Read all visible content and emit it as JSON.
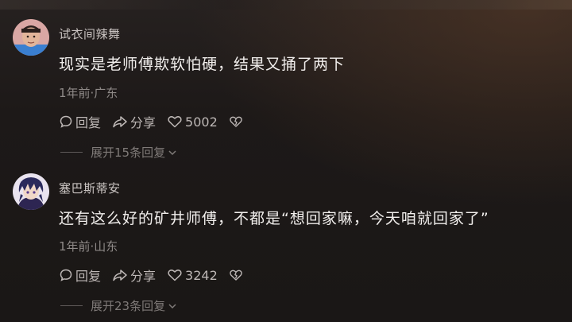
{
  "comments": [
    {
      "username": "试衣间辣舞",
      "text": "现实是老师傅欺软怕硬，结果又捅了两下",
      "meta": "1年前·广东",
      "reply_label": "回复",
      "share_label": "分享",
      "like_count": "5002",
      "expand_label": "展开15条回复",
      "avatar_icon": "avatar-boy-photo"
    },
    {
      "username": "塞巴斯蒂安",
      "text": "还有这么好的矿井师傅，不都是“想回家嘛，今天咱就回家了”",
      "meta": "1年前·山东",
      "reply_label": "回复",
      "share_label": "分享",
      "like_count": "3242",
      "expand_label": "展开23条回复",
      "avatar_icon": "avatar-anime-character"
    }
  ],
  "colors": {
    "background": "#1b1716",
    "username": "#c9c3c1",
    "text": "#f1eeec",
    "meta": "#8f8a88",
    "actions": "#bdb7b5"
  }
}
